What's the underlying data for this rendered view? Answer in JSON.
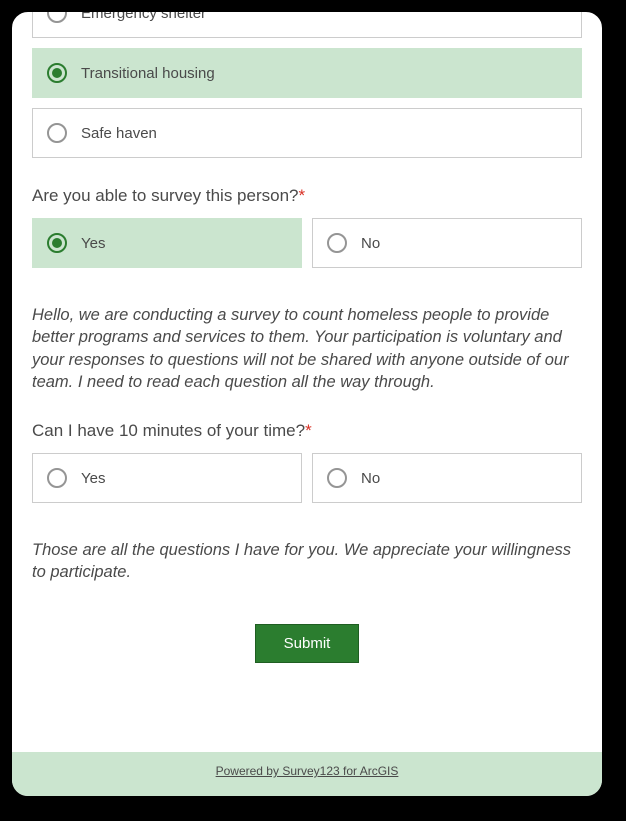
{
  "q1": {
    "options": [
      {
        "label": "Emergency shelter",
        "selected": false
      },
      {
        "label": "Transitional housing",
        "selected": true
      },
      {
        "label": "Safe haven",
        "selected": false
      }
    ]
  },
  "q2": {
    "label": "Are you able to survey this person?",
    "required_mark": "*",
    "options": [
      {
        "label": "Yes",
        "selected": true
      },
      {
        "label": "No",
        "selected": false
      }
    ]
  },
  "intro_text": "Hello, we are conducting a survey to count homeless people to provide better programs and services to them. Your participation is voluntary and your responses to questions will not be shared with anyone outside of our team. I need to read each question all the way through.",
  "q3": {
    "label": "Can I have 10 minutes of your time?",
    "required_mark": "*",
    "options": [
      {
        "label": "Yes",
        "selected": false
      },
      {
        "label": "No",
        "selected": false
      }
    ]
  },
  "outro_text": "Those are all the questions I have for you. We appreciate your willingness to participate.",
  "submit_label": "Submit",
  "footer_text": "Powered by Survey123 for ArcGIS"
}
